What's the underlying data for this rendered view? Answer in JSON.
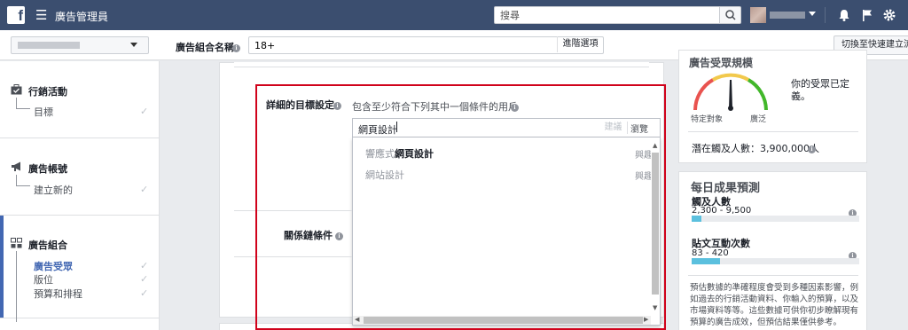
{
  "app": {
    "title": "廣告管理員",
    "logo": "f"
  },
  "topbar": {
    "search_placeholder": "搜尋",
    "icons": [
      "menu-icon",
      "search-icon",
      "bell-icon",
      "flag-icon",
      "gear-icon"
    ]
  },
  "subbar": {
    "adset_name_label": "廣告組合名稱",
    "adset_name_value": "18+",
    "advanced_options": "進階選項",
    "quick_create": "切換至快速建立流程"
  },
  "leftnav": {
    "campaign": {
      "title": "行銷活動",
      "items": [
        "目標"
      ]
    },
    "ad_account": {
      "title": "廣告帳號",
      "items": [
        "建立新的"
      ]
    },
    "ad_set": {
      "title": "廣告組合",
      "items": [
        "廣告受眾",
        "版位",
        "預算和排程"
      ]
    },
    "check": "✓"
  },
  "main": {
    "detailed_targeting_label": "詳細的目標設定",
    "detailed_targeting_desc": "包含至少符合下列其中一個條件的用戶",
    "targeting_input_value": "網頁設計",
    "suggestions_label": "建議",
    "browse_label": "瀏覽",
    "dropdown": [
      {
        "prefix": "響應式",
        "match": "網頁設計",
        "right": "興趣"
      },
      {
        "prefix": "網站設計",
        "match": "",
        "right": "興趣"
      }
    ],
    "connections_label": "關係鏈條件"
  },
  "audience": {
    "title": "廣告受眾規模",
    "specific": "特定對象",
    "broad": "廣泛",
    "defined_text": "你的受眾已定義。",
    "potential_reach": "潛在觸及人數：3,900,000人"
  },
  "daily": {
    "title": "每日成果預測",
    "reach_label": "觸及人數",
    "reach_range": "2,300 - 9,500",
    "reach_fill_fraction": 0.06,
    "engagement_label": "貼文互動次數",
    "engagement_range": "83 - 420",
    "engagement_fill_fraction": 0.17,
    "note": "預估數據的準確程度會受到多種因素影響，例如過去的行銷活動資料、你輸入的預算，以及市場資料等等。這些數據可供你初步瞭解現有預算的廣告成效，但預估結果僅供參考。"
  },
  "colors": {
    "topbar": "#3b4e6f",
    "highlight": "#d0021b",
    "accent": "#4267b2",
    "bar": "#5bc0de"
  }
}
